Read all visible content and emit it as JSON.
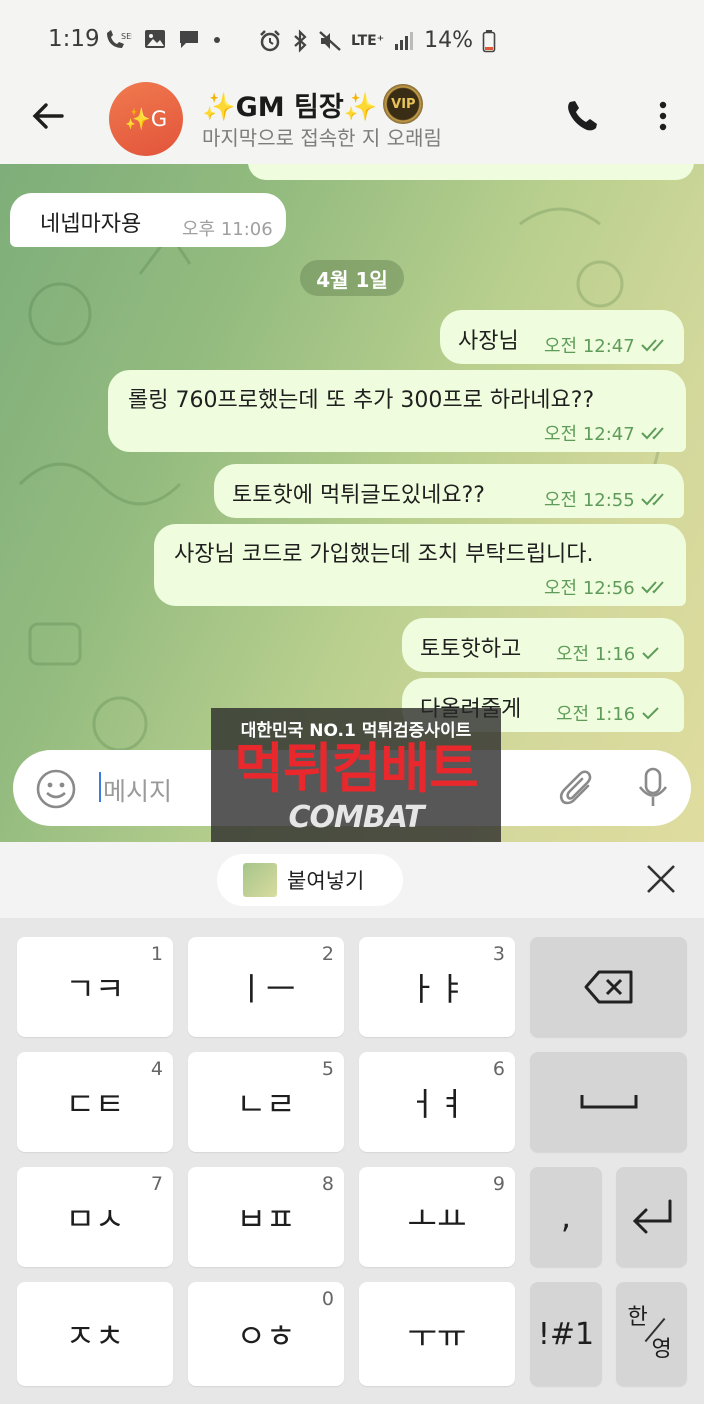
{
  "status_bar": {
    "time": "1:19",
    "left_icons": [
      "missed-call-icon",
      "image-icon",
      "message-icon",
      "dot-icon"
    ],
    "right_icons": [
      "alarm-icon",
      "bluetooth-icon",
      "mute-icon",
      "lte-icon",
      "signal-icon"
    ],
    "network": "LTE⁺",
    "battery": "14%"
  },
  "header": {
    "avatar_text": "✨G",
    "title": "✨GM 팀장✨",
    "badge": "VIP",
    "subtitle": "마지막으로 접속한 지 오래림"
  },
  "chat": {
    "messages": [
      {
        "dir": "in",
        "text": "네넵마자용",
        "time": "오후 11:06"
      },
      {
        "dir": "date",
        "text": "4월 1일"
      },
      {
        "dir": "out",
        "text": "사장님",
        "time": "오전 12:47",
        "status": "read"
      },
      {
        "dir": "out",
        "text": "롤링 760프로했는데 또 추가 300프로 하라네요??",
        "time": "오전 12:47",
        "status": "read"
      },
      {
        "dir": "out",
        "text": "토토핫에 먹튀글도있네요??",
        "time": "오전 12:55",
        "status": "read"
      },
      {
        "dir": "out",
        "text": "사장님 코드로 가입했는데 조치 부탁드립니다.",
        "time": "오전 12:56",
        "status": "read"
      },
      {
        "dir": "out",
        "text": "토토핫하고",
        "time": "오전 1:16",
        "status": "sent"
      },
      {
        "dir": "out",
        "text": "다올려줄게",
        "time": "오전 1:16",
        "status": "sent"
      }
    ]
  },
  "input": {
    "placeholder": "메시지"
  },
  "watermark": {
    "line1": "대한민국 NO.1 먹튀검증사이트",
    "line2": "먹튀컴배트",
    "line3": "COMBAT"
  },
  "paste_bar": {
    "label": "붙여넣기"
  },
  "keyboard": {
    "rows": [
      [
        {
          "label": "ㄱㅋ",
          "num": "1"
        },
        {
          "label": "ㅣㅡ",
          "num": "2"
        },
        {
          "label": "ㅏㅑ",
          "num": "3"
        }
      ],
      [
        {
          "label": "ㄷㅌ",
          "num": "4"
        },
        {
          "label": "ㄴㄹ",
          "num": "5"
        },
        {
          "label": "ㅓㅕ",
          "num": "6"
        }
      ],
      [
        {
          "label": "ㅁㅅ",
          "num": "7"
        },
        {
          "label": "ㅂㅍ",
          "num": "8"
        },
        {
          "label": "ㅗㅛ",
          "num": "9"
        }
      ],
      [
        {
          "label": "ㅈㅊ",
          "num": ""
        },
        {
          "label": "ㅇㅎ",
          "num": "0"
        },
        {
          "label": "ㅜㅠ",
          "num": ""
        }
      ]
    ],
    "comma": ",",
    "symbols": "!#1",
    "lang_a": "한",
    "lang_b": "영"
  }
}
